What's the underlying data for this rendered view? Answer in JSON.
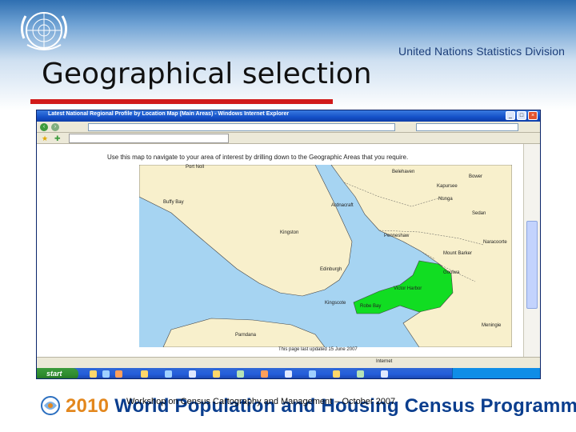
{
  "slide": {
    "title": "Geographical selection",
    "organization": "United Nations Statistics Division",
    "footer_year": "2010",
    "footer_programme": "World Population and Housing Census Programme",
    "workshop_note": "Workshop on Census Cartography and Management – October 2007"
  },
  "browser": {
    "window_title": "Latest National Regional Profile by Location Map (Main Areas) - Windows Internet Explorer",
    "instruction": "Use this map to navigate to your area of interest by drilling down to the Geographic Areas that you require.",
    "footnote": "This page last updated 15 June 2007",
    "status_zone": "Internet",
    "start_label": "start"
  },
  "map": {
    "areas": [
      {
        "name": "Port Noll"
      },
      {
        "name": "Buffy Bay"
      },
      {
        "name": "Ardnacraft"
      },
      {
        "name": "Belehaven"
      },
      {
        "name": "Bower"
      },
      {
        "name": "Kapursee"
      },
      {
        "name": "Nunga"
      },
      {
        "name": "Sedan"
      },
      {
        "name": "Kingston"
      },
      {
        "name": "Edinburgh"
      },
      {
        "name": "Mount Barker"
      },
      {
        "name": "Kingscote"
      },
      {
        "name": "Penneshaw"
      },
      {
        "name": "Victor Harbor"
      },
      {
        "name": "Goolwa"
      },
      {
        "name": "Robe Bay"
      },
      {
        "name": "Meningie"
      },
      {
        "name": "Naracoorte"
      },
      {
        "name": "Parndana"
      }
    ],
    "colors": {
      "sea": "#a6d4f2",
      "land": "#f8f0cc",
      "island": "#f8f0cc",
      "selected": "#11dd22",
      "border": "#444444"
    }
  }
}
